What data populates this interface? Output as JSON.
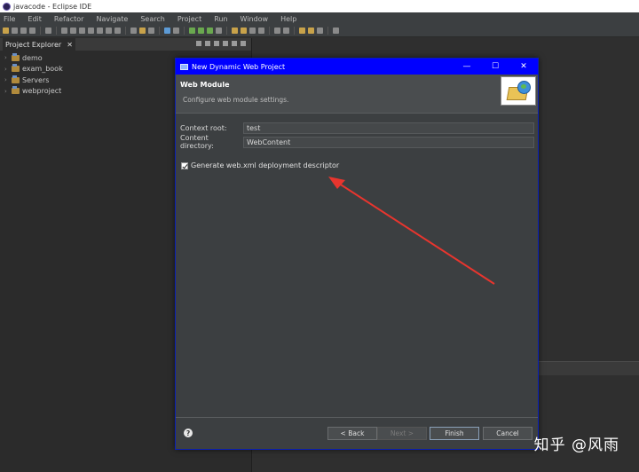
{
  "window": {
    "title": "javacode - Eclipse IDE"
  },
  "menu": [
    "File",
    "Edit",
    "Refactor",
    "Navigate",
    "Search",
    "Project",
    "Run",
    "Window",
    "Help"
  ],
  "explorer": {
    "tab_label": "Project Explorer",
    "close": "✕",
    "items": [
      {
        "label": "demo"
      },
      {
        "label": "exam_book"
      },
      {
        "label": "Servers"
      },
      {
        "label": "webproject"
      }
    ]
  },
  "dialog": {
    "title": "New Dynamic Web Project",
    "minimize": "—",
    "maximize": "☐",
    "close": "✕",
    "header_title": "Web Module",
    "header_desc": "Configure web module settings.",
    "context_root_label": "Context root:",
    "context_root_value": "test",
    "content_dir_label": "Content directory:",
    "content_dir_value": "WebContent",
    "checkbox_label": "Generate web.xml deployment descriptor",
    "checkbox_checked": true,
    "help": "?",
    "buttons": {
      "back": "< Back",
      "next": "Next >",
      "finish": "Finish",
      "cancel": "Cancel"
    }
  },
  "watermark": "知乎 @风雨",
  "colors": {
    "dialog_title_bg": "#0000ff",
    "arrow": "#e8352e"
  }
}
